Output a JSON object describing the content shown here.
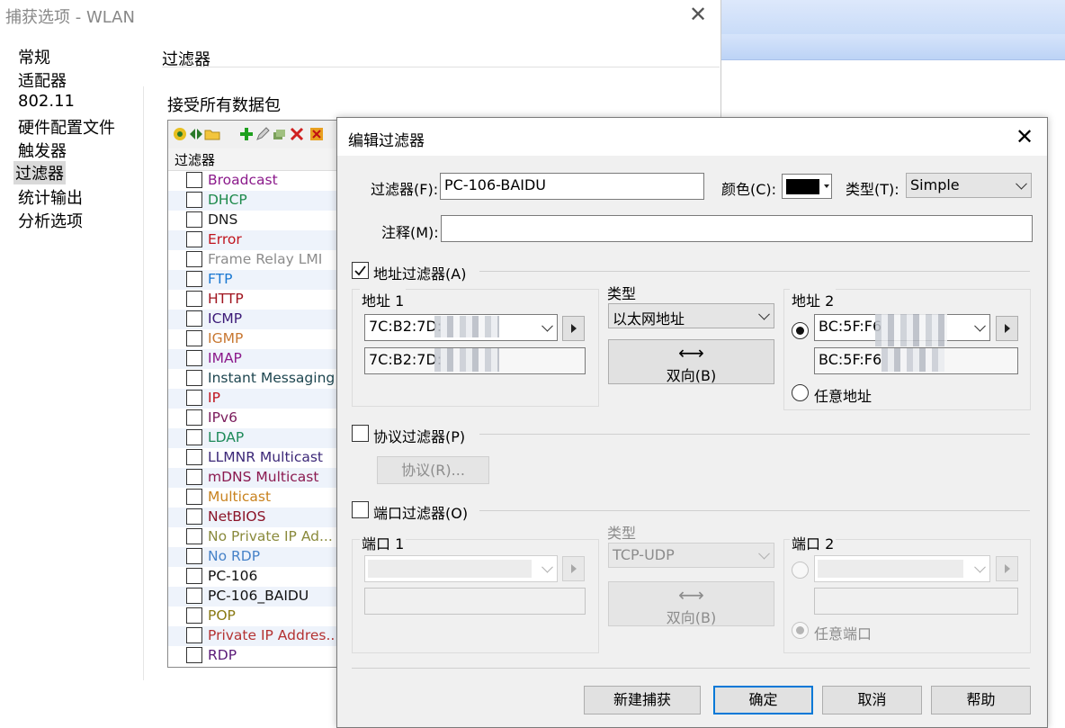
{
  "capture_window": {
    "title": "捕获选项 - WLAN",
    "close_glyph": "✕",
    "nav": [
      "常规",
      "适配器",
      "802.11",
      "硬件配置文件",
      "触发器",
      "过滤器",
      "统计输出",
      "分析选项"
    ],
    "selected_nav": "过滤器",
    "section_title": "过滤器",
    "accept_label": "接受所有数据包",
    "filter_column_header": "过滤器",
    "filters": [
      {
        "name": "Broadcast",
        "color": "#8b1a8b"
      },
      {
        "name": "DHCP",
        "color": "#1e8a4c"
      },
      {
        "name": "DNS",
        "color": "#1a1a1a"
      },
      {
        "name": "Error",
        "color": "#c0141e"
      },
      {
        "name": "Frame Relay LMI",
        "color": "#8c8c8c"
      },
      {
        "name": "FTP",
        "color": "#1a78d2"
      },
      {
        "name": "HTTP",
        "color": "#a0141e"
      },
      {
        "name": "ICMP",
        "color": "#3c1a78"
      },
      {
        "name": "IGMP",
        "color": "#c87832"
      },
      {
        "name": "IMAP",
        "color": "#8b1a8b"
      },
      {
        "name": "Instant Messaging",
        "color": "#1e4650"
      },
      {
        "name": "IP",
        "color": "#c0141e"
      },
      {
        "name": "IPv6",
        "color": "#7a1a5a"
      },
      {
        "name": "LDAP",
        "color": "#1e8a5a"
      },
      {
        "name": "LLMNR Multicast",
        "color": "#3c2878"
      },
      {
        "name": "mDNS Multicast",
        "color": "#8b1a50"
      },
      {
        "name": "Multicast",
        "color": "#c8821e"
      },
      {
        "name": "NetBIOS",
        "color": "#8b1428"
      },
      {
        "name": "No Private IP Ad...",
        "color": "#8a8a3c"
      },
      {
        "name": "No RDP",
        "color": "#4682c8"
      },
      {
        "name": "PC-106",
        "color": "#111111"
      },
      {
        "name": "PC-106_BAIDU",
        "color": "#111111"
      },
      {
        "name": "POP",
        "color": "#8a7a14"
      },
      {
        "name": "Private IP Addres...",
        "color": "#b43232"
      },
      {
        "name": "RDP",
        "color": "#5a1a78"
      }
    ]
  },
  "edit_dialog": {
    "title": "编辑过滤器",
    "close_glyph": "✕",
    "filter_label": "过滤器(F):",
    "filter_value": "PC-106-BAIDU",
    "color_label": "颜色(C):",
    "color_value": "#000000",
    "type_label": "类型(T):",
    "type_value": "Simple",
    "comment_label": "注释(M):",
    "comment_value": "",
    "address_filter": {
      "label": "地址过滤器(A)",
      "checked": true,
      "addr1_label": "地址 1",
      "addr1_combo": "7C:B2:7D:",
      "addr1_text": "7C:B2:7D:",
      "type_label": "类型",
      "type_value": "以太网地址",
      "direction_glyph": "⟷",
      "direction_label": "双向(B)",
      "addr2_label": "地址 2",
      "addr2_combo": "BC:5F:F6",
      "addr2_text": "BC:5F:F6",
      "any_address_label": "任意地址"
    },
    "protocol_filter": {
      "label": "协议过滤器(P)",
      "checked": false,
      "protocol_button": "协议(R)..."
    },
    "port_filter": {
      "label": "端口过滤器(O)",
      "checked": false,
      "port1_label": "端口 1",
      "type_label": "类型",
      "type_value": "TCP-UDP",
      "direction_glyph": "⟷",
      "direction_label": "双向(B)",
      "port2_label": "端口 2",
      "any_port_label": "任意端口"
    },
    "buttons": {
      "new_capture": "新建捕获",
      "ok": "确定",
      "cancel": "取消",
      "help": "帮助"
    }
  }
}
